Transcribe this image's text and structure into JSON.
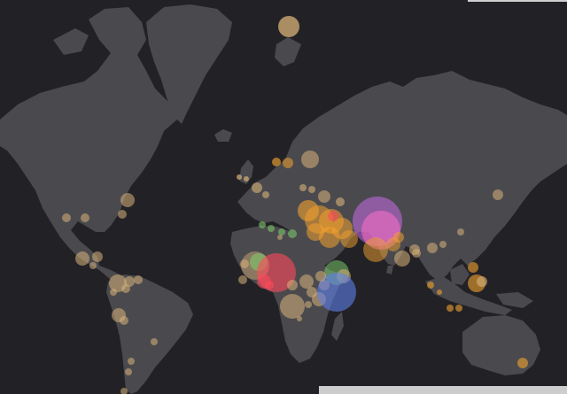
{
  "map": {
    "background": "#222226",
    "land_color": "#4a4a4e",
    "color_legend": {
      "orange": "#f2a12e",
      "tan": "#d9b27a",
      "red": "#ff4a5a",
      "green": "#7fd16b",
      "blue": "#5f7fe8",
      "purple": "#c86be8",
      "pink": "#ff70c8"
    }
  },
  "attribution": ""
}
